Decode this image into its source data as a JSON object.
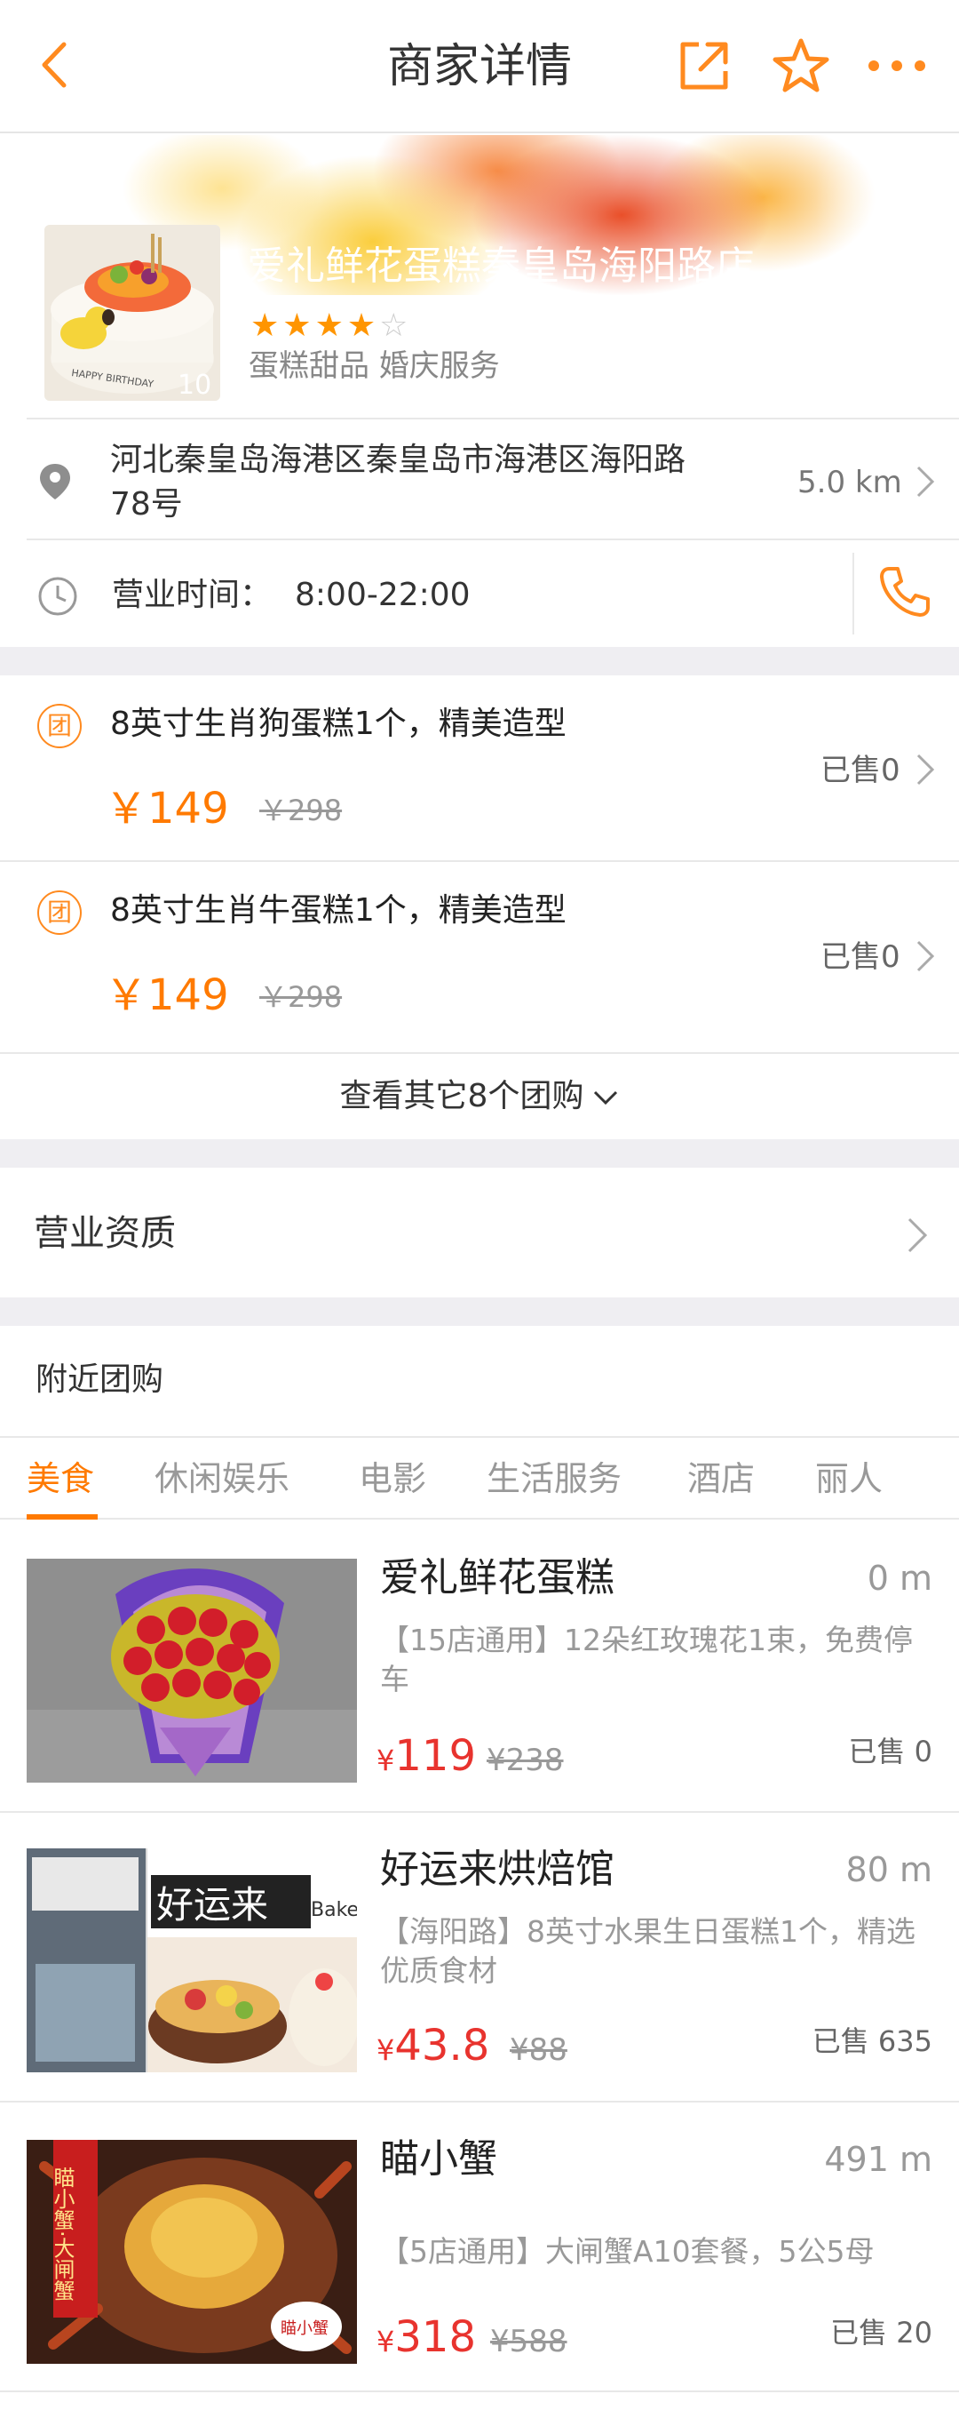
{
  "nav": {
    "title": "商家详情"
  },
  "shop": {
    "name": "爱礼鲜花蛋糕秦皇岛海阳路店",
    "rating": 4,
    "rating_max": 5,
    "categories": "蛋糕甜品 婚庆服务",
    "thumb_text": "HAPPY BIRTHDAY",
    "thumb_number": "10"
  },
  "address": {
    "text": "河北秦皇岛海港区秦皇岛市海港区海阳路78号",
    "distance": "5.0 km"
  },
  "hours": {
    "label": "营业时间：",
    "value": "8:00-22:00"
  },
  "deals": [
    {
      "badge": "团",
      "title": "8英寸生肖狗蛋糕1个，精美造型",
      "price": "￥149",
      "original": "￥298",
      "sold": "已售0"
    },
    {
      "badge": "团",
      "title": "8英寸生肖牛蛋糕1个，精美造型",
      "price": "￥149",
      "original": "￥298",
      "sold": "已售0"
    }
  ],
  "more_deals": "查看其它8个团购",
  "license": {
    "label": "营业资质"
  },
  "nearby": {
    "label": "附近团购",
    "tabs": [
      "美食",
      "休闲娱乐",
      "电影",
      "生活服务",
      "酒店",
      "丽人"
    ],
    "active_tab": "美食",
    "items": [
      {
        "name": "爱礼鲜花蛋糕",
        "distance": "0 m",
        "desc": "【15店通用】12朵红玫瑰花1束，免费停车",
        "yen": "¥",
        "price": "119",
        "original": "¥238",
        "sold": "已售 0"
      },
      {
        "name": "好运来烘焙馆",
        "distance": "80 m",
        "desc": "【海阳路】8英寸水果生日蛋糕1个，精选优质食材",
        "yen": "¥",
        "price": "43.8",
        "original": "¥88",
        "sold": "已售 635",
        "img_text_1": "好运来",
        "img_text_2": "Bake"
      },
      {
        "name": "瞄小蟹",
        "distance": "491 m",
        "desc": "【5店通用】大闸蟹A10套餐，5公5母",
        "yen": "¥",
        "price": "318",
        "original": "¥588",
        "sold": "已售 20",
        "img_banner": "瞄小蟹·大闸蟹",
        "img_logo": "瞄小蟹"
      }
    ]
  },
  "colors": {
    "accent": "#ff7a00",
    "price_red": "#e8332e",
    "band": "#efeef2"
  }
}
